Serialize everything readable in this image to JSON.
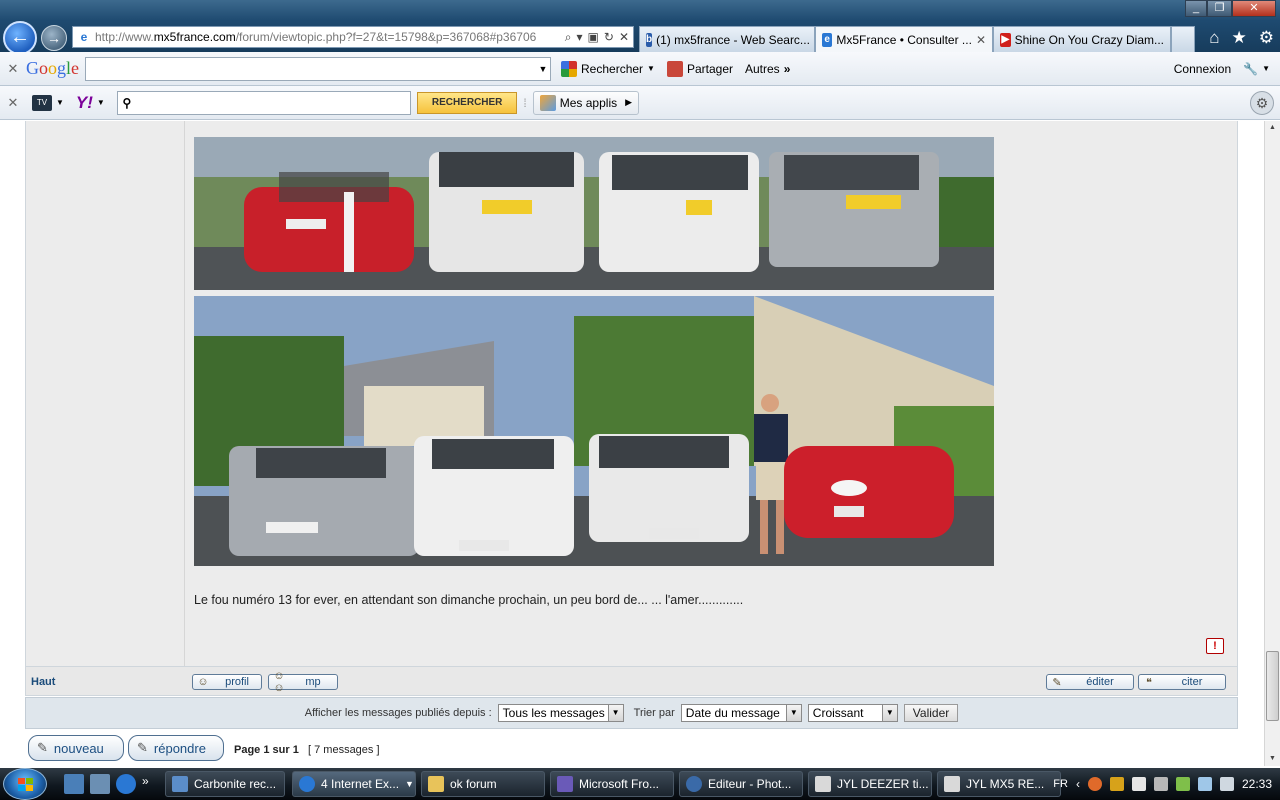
{
  "browser": {
    "url_prefix": "http://www.",
    "url_domain": "mx5france.com",
    "url_path": "/forum/viewtopic.php?f=27&t=15798&p=367068#p36706",
    "tabs": [
      {
        "label": "(1) mx5france - Web Searc...",
        "icon": "bing-icon",
        "active": false
      },
      {
        "label": "Mx5France • Consulter ...",
        "icon": "ie-page-icon",
        "active": true
      },
      {
        "label": "Shine On You Crazy Diam...",
        "icon": "youtube-icon",
        "active": false
      }
    ]
  },
  "google_toolbar": {
    "logo": "Google",
    "search_value": "",
    "rechercher": "Rechercher",
    "partager": "Partager",
    "autres": "Autres",
    "connexion": "Connexion"
  },
  "yahoo_toolbar": {
    "search_value": "",
    "button": "RECHERCHER",
    "mes_applis": "Mes applis"
  },
  "post": {
    "text": "Le fou numéro 13 for ever, en attendant son dimanche prochain, un peu bord de... ... l'amer.............",
    "images": [
      {
        "description": "rear view of four cars"
      },
      {
        "description": "four cars with man in number 13 shirt"
      }
    ],
    "report_label": "!"
  },
  "post_actions": {
    "haut": "Haut",
    "profil": "profil",
    "mp": "mp",
    "editer": "éditer",
    "citer": "citer"
  },
  "filter": {
    "afficher_label": "Afficher les messages publiés depuis :",
    "afficher_value": "Tous les messages",
    "trier_label": "Trier par",
    "trier_value": "Date du message",
    "order_value": "Croissant",
    "valider": "Valider"
  },
  "topic_actions": {
    "nouveau": "nouveau",
    "repondre": "répondre",
    "page_info": "Page 1 sur 1",
    "messages_count": "[ 7 messages ]"
  },
  "taskbar": {
    "tasks": [
      {
        "label": "Carbonite rec...",
        "icon": "carbonite-icon"
      },
      {
        "label": "4 Internet Ex...",
        "icon": "ie-icon"
      },
      {
        "label": "ok forum",
        "icon": "folder-icon"
      },
      {
        "label": "Microsoft Fro...",
        "icon": "frontpage-icon"
      },
      {
        "label": "Editeur - Phot...",
        "icon": "photo-editor-icon"
      },
      {
        "label": "JYL   DEEZER ti...",
        "icon": "document-icon"
      },
      {
        "label": "JYL   MX5   RE...",
        "icon": "document-icon"
      }
    ],
    "lang": "FR",
    "clock": "22:33"
  },
  "colors": {
    "link": "#1a4b7a",
    "toolbar_bg": "#e4eaf1",
    "post_bg": "#ececec",
    "title_bar": "#1e4a70"
  }
}
